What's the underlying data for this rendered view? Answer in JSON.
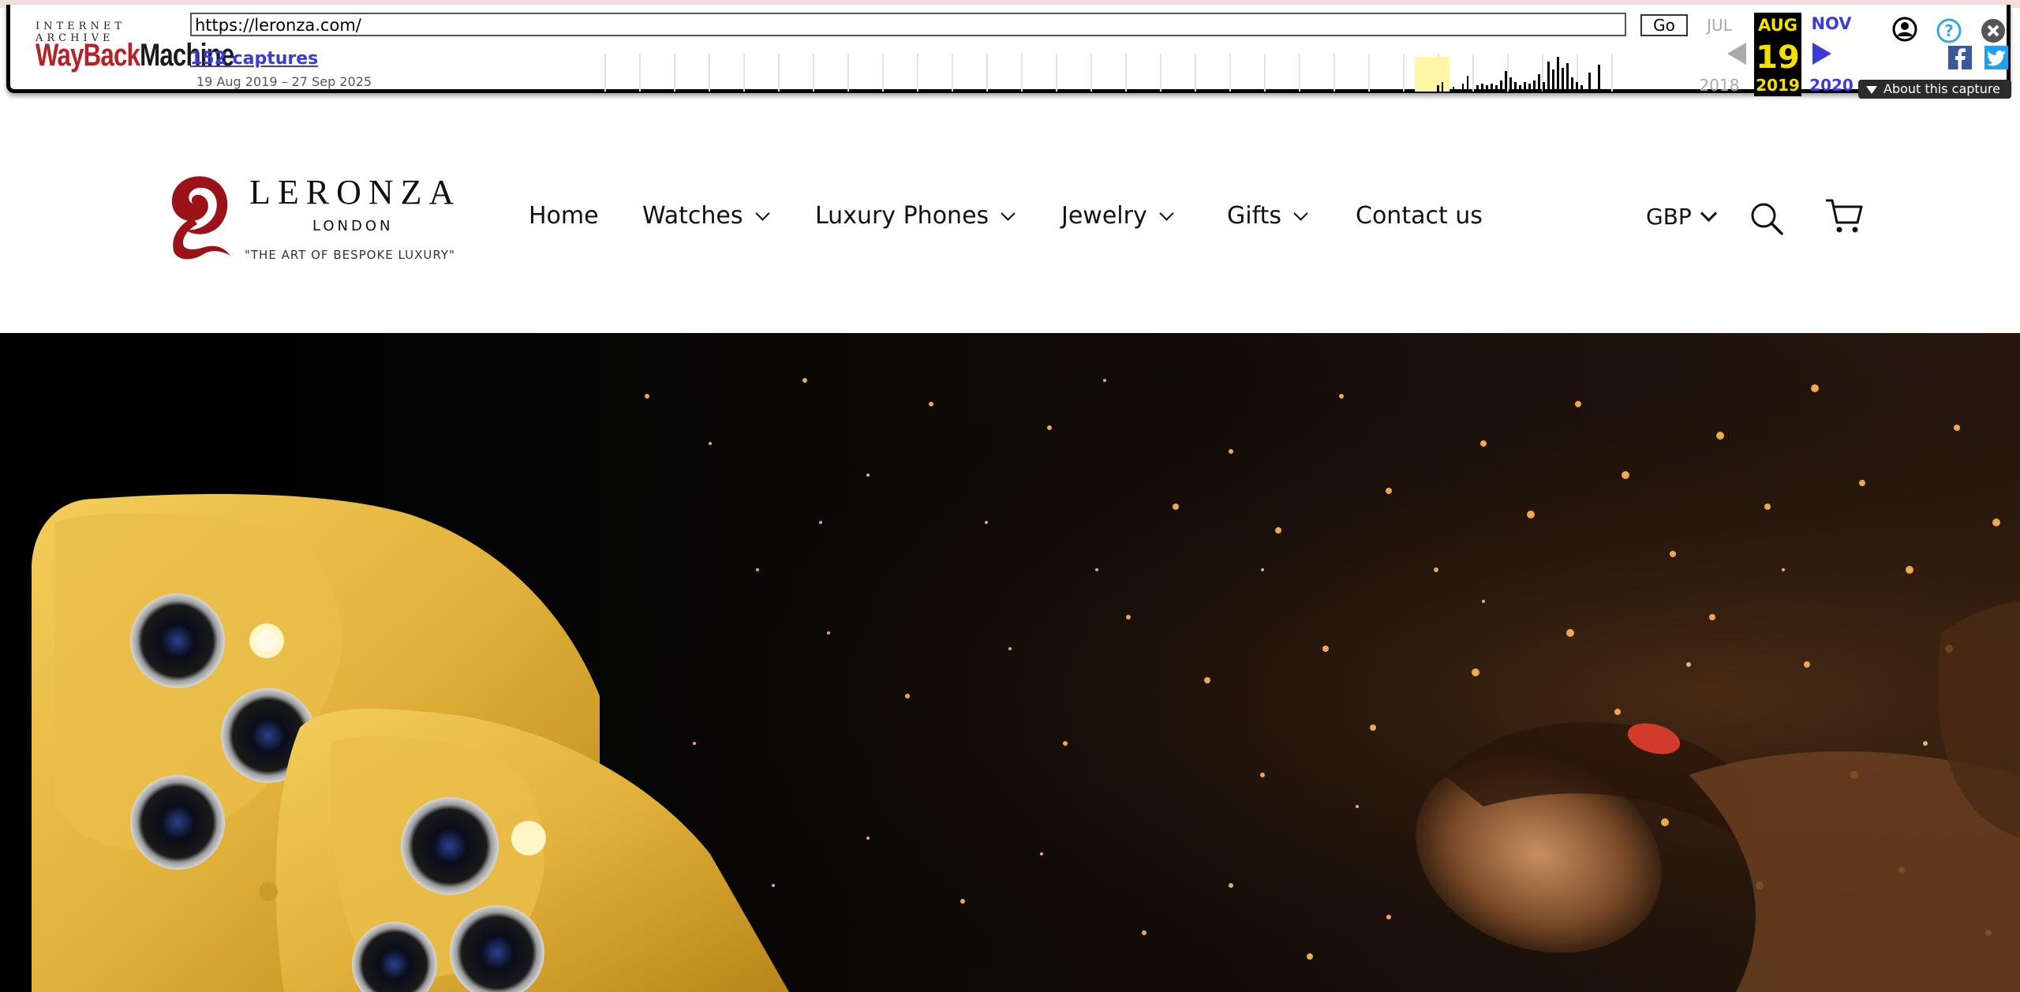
{
  "wayback": {
    "logo_top": "INTERNET ARCHIVE",
    "logo_way": "WayBack",
    "logo_machine": "Machine",
    "url": "https://leronza.com/",
    "go_label": "Go",
    "captures_label": "152 captures",
    "date_range": "19 Aug 2019 – 27 Sep 2025",
    "prev_month": "JUL",
    "prev_year": "2018",
    "current_month": "AUG",
    "current_day": "19",
    "current_year": "2019",
    "next_month": "NOV",
    "next_year": "2020",
    "about_label": "About this capture",
    "icons": [
      "user-icon",
      "help-icon",
      "close-icon",
      "facebook-icon",
      "twitter-icon"
    ],
    "colors": {
      "accent": "#3b3bd6",
      "highlight": "#f5e000",
      "logo_red": "#b32227"
    }
  },
  "site": {
    "brand": "LERONZA",
    "city": "LONDON",
    "tagline": "\"THE ART OF BESPOKE LUXURY\"",
    "nav": [
      {
        "label": "Home",
        "dropdown": false
      },
      {
        "label": "Watches",
        "dropdown": true
      },
      {
        "label": "Luxury Phones",
        "dropdown": true
      },
      {
        "label": "Jewelry",
        "dropdown": true
      },
      {
        "label": "Gifts",
        "dropdown": true
      },
      {
        "label": "Contact us",
        "dropdown": false
      }
    ],
    "currency": "GBP",
    "icons": [
      "search-icon",
      "cart-icon"
    ],
    "colors": {
      "logo_red": "#9b1218",
      "gold": "#e2b23a"
    }
  }
}
